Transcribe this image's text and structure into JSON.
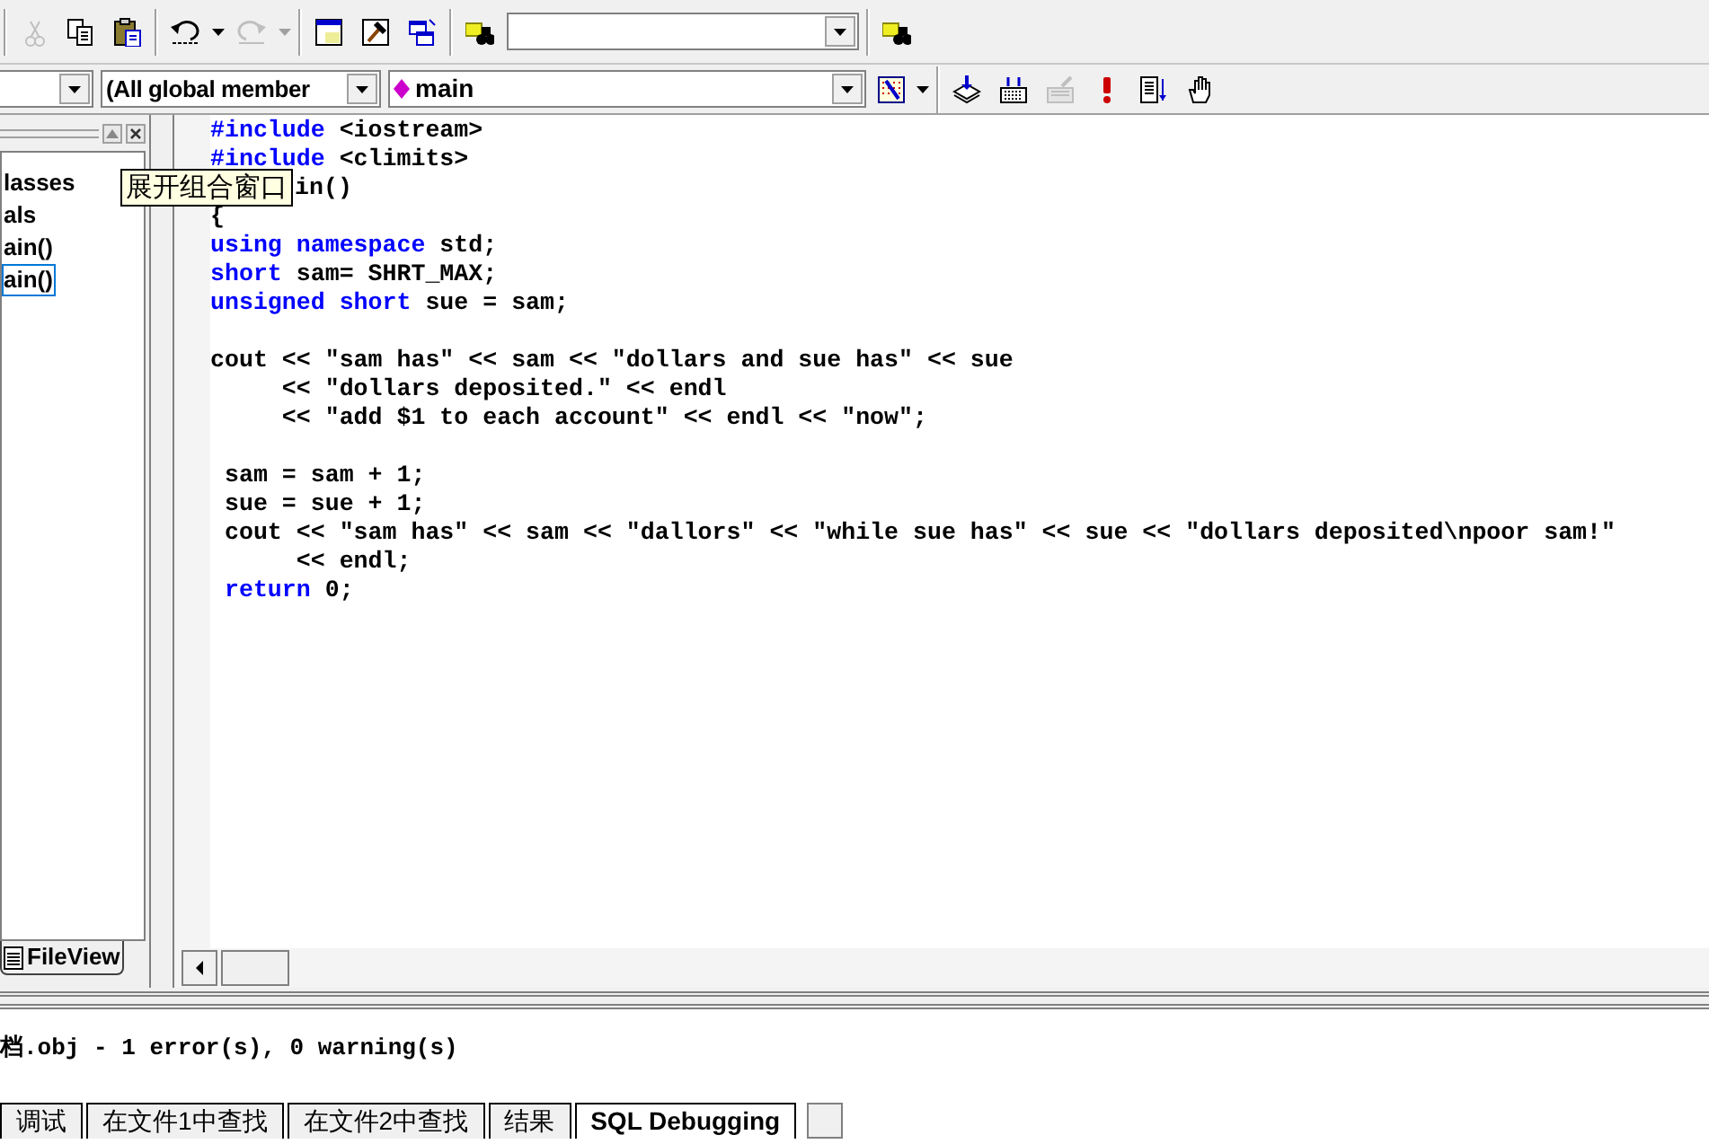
{
  "toolbar": {
    "buttons": [
      {
        "kind": "cut",
        "disabled": true
      },
      {
        "kind": "copy",
        "disabled": false
      },
      {
        "kind": "paste",
        "disabled": false
      },
      {
        "kind": "undo",
        "disabled": false
      },
      {
        "kind": "redo",
        "disabled": true
      },
      {
        "kind": "workspace",
        "disabled": false
      },
      {
        "kind": "output",
        "disabled": false
      },
      {
        "kind": "windows",
        "disabled": false
      },
      {
        "kind": "find",
        "disabled": false
      }
    ]
  },
  "wizard_bar": {
    "class_combo": "(All global member",
    "function_combo": "main",
    "build_buttons": [
      {
        "kind": "compile",
        "disabled": false
      },
      {
        "kind": "build",
        "disabled": false
      },
      {
        "kind": "stop",
        "disabled": true
      },
      {
        "kind": "execute",
        "disabled": false
      },
      {
        "kind": "step",
        "disabled": false
      },
      {
        "kind": "breakpoint",
        "disabled": false
      }
    ]
  },
  "workspace": {
    "items": [
      {
        "label": "lasses",
        "selected": false
      },
      {
        "label": "als",
        "selected": false
      },
      {
        "label": "ain()",
        "selected": false
      },
      {
        "label": "ain()",
        "selected": true
      }
    ],
    "tab": "FileView"
  },
  "tooltip": "展开组合窗口",
  "editor": {
    "lines": [
      {
        "kind": "code",
        "tokens": [
          {
            "kind": "keyword",
            "text": "#include"
          },
          {
            "kind": "plain",
            "text": " <iostream>"
          }
        ]
      },
      {
        "kind": "code",
        "tokens": [
          {
            "kind": "keyword",
            "text": "#include"
          },
          {
            "kind": "plain",
            "text": " <climits>"
          }
        ]
      },
      {
        "kind": "covered",
        "tokens": [
          {
            "kind": "plain",
            "text": "in()"
          }
        ]
      },
      {
        "kind": "code",
        "tokens": [
          {
            "kind": "plain",
            "text": "{"
          }
        ]
      },
      {
        "kind": "code",
        "tokens": [
          {
            "kind": "keyword",
            "text": "using namespace"
          },
          {
            "kind": "plain",
            "text": " std;"
          }
        ]
      },
      {
        "kind": "code",
        "tokens": [
          {
            "kind": "keyword",
            "text": "short"
          },
          {
            "kind": "plain",
            "text": " sam= SHRT_MAX;"
          }
        ]
      },
      {
        "kind": "code",
        "tokens": [
          {
            "kind": "keyword",
            "text": "unsigned short"
          },
          {
            "kind": "plain",
            "text": " sue = sam;"
          }
        ]
      },
      {
        "kind": "blank"
      },
      {
        "kind": "code",
        "tokens": [
          {
            "kind": "plain",
            "text": "cout << \"sam has\" << sam << \"dollars and sue has\" << sue"
          }
        ]
      },
      {
        "kind": "code",
        "tokens": [
          {
            "kind": "plain",
            "text": "     << \"dollars deposited.\" << endl"
          }
        ]
      },
      {
        "kind": "code",
        "tokens": [
          {
            "kind": "plain",
            "text": "     << \"add $1 to each account\" << endl << \"now\";"
          }
        ]
      },
      {
        "kind": "blank"
      },
      {
        "kind": "code",
        "tokens": [
          {
            "kind": "plain",
            "text": " sam = sam + 1;"
          }
        ]
      },
      {
        "kind": "code",
        "tokens": [
          {
            "kind": "plain",
            "text": " sue = sue + 1;"
          }
        ]
      },
      {
        "kind": "code",
        "tokens": [
          {
            "kind": "plain",
            "text": " cout << \"sam has\" << sam << \"dallors\" << \"while sue has\" << sue << \"dollars deposited\\npoor sam!\""
          }
        ]
      },
      {
        "kind": "code",
        "tokens": [
          {
            "kind": "plain",
            "text": "      << endl;"
          }
        ]
      },
      {
        "kind": "code",
        "tokens": [
          {
            "kind": "keyword",
            "text": " return"
          },
          {
            "kind": "plain",
            "text": " 0;"
          }
        ]
      }
    ]
  },
  "output": {
    "text": "档.obj - 1 error(s), 0 warning(s)",
    "tabs": [
      {
        "label": "调试",
        "selected": false
      },
      {
        "label": "在文件1中查找",
        "selected": false
      },
      {
        "label": "在文件2中查找",
        "selected": false
      },
      {
        "label": "结果",
        "selected": false
      },
      {
        "label": "SQL Debugging",
        "selected": true
      }
    ]
  }
}
